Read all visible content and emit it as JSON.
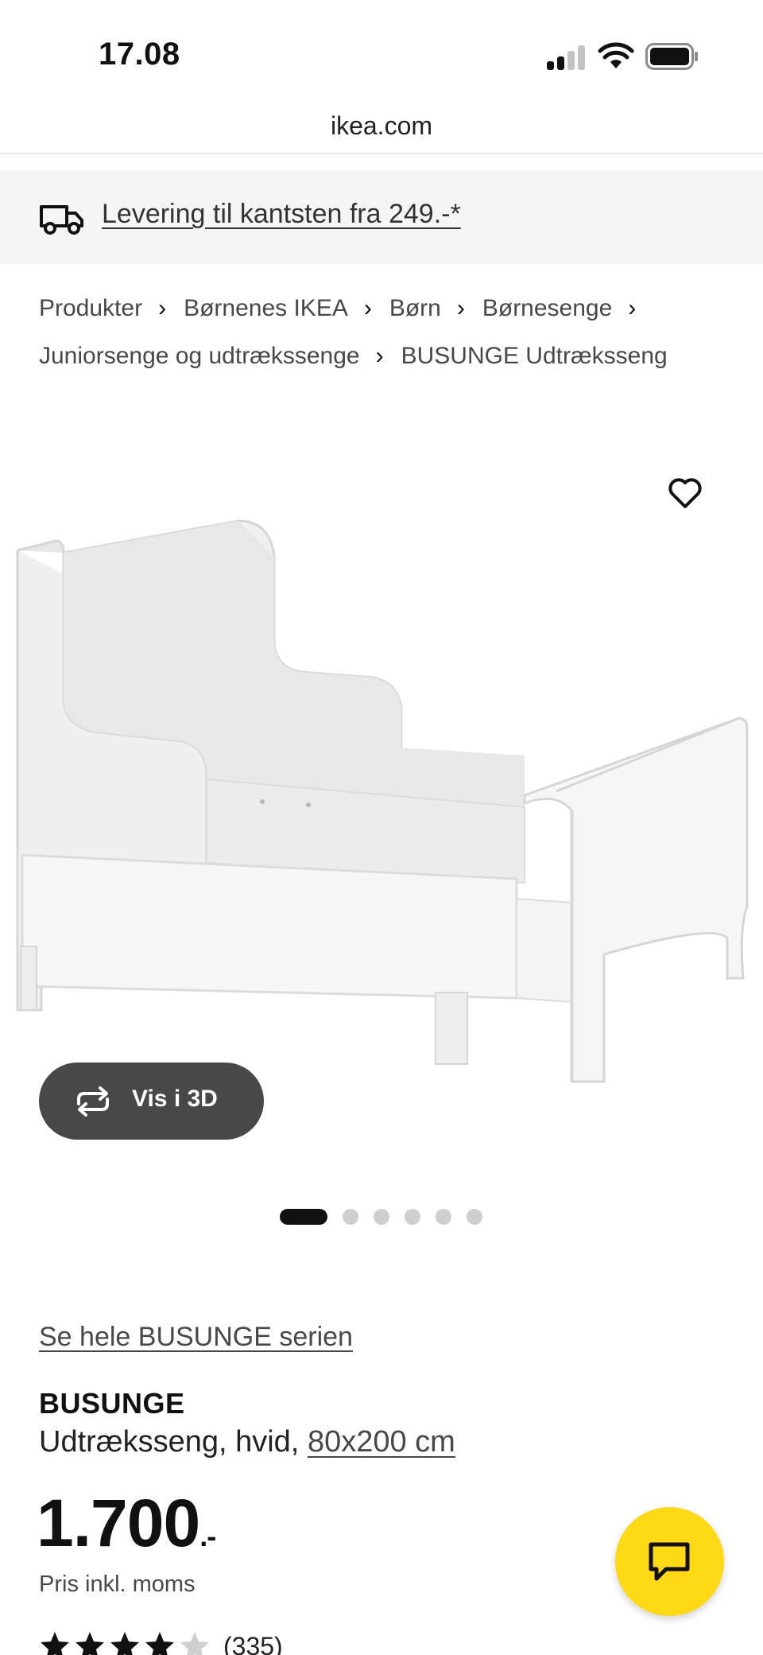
{
  "status_bar": {
    "time": "17.08",
    "icons": [
      "cellular-signal-icon",
      "wifi-icon",
      "battery-icon"
    ]
  },
  "browser": {
    "url": "ikea.com"
  },
  "delivery_banner": {
    "icon": "truck-icon",
    "text": "Levering til kantsten fra 249.-*"
  },
  "breadcrumb": {
    "items": [
      "Produkter",
      "Børnenes IKEA",
      "Børn",
      "Børnesenge",
      "Juniorsenge og udtrækssenge",
      "BUSUNGE Udtræksseng"
    ],
    "separator": "›"
  },
  "gallery": {
    "favorite_icon": "heart-icon",
    "view_3d_label": "Vis i 3D",
    "view_3d_icon": "rotate-arrows-icon",
    "image_count": 6,
    "active_index": 0
  },
  "product": {
    "series_link": "Se hele BUSUNGE serien",
    "name": "BUSUNGE",
    "description_prefix": "Udtræksseng, hvid,",
    "size": "80x200 cm",
    "price": "1.700",
    "price_suffix": ".-",
    "price_note": "Pris inkl. moms",
    "rating": 4.5,
    "review_count": "(335)"
  },
  "chat": {
    "icon": "chat-bubble-icon"
  },
  "colors": {
    "background": "#ffffff",
    "banner_background": "#f5f5f5",
    "button_dark": "#484848",
    "chat_yellow": "#fed914",
    "text_primary": "#111111",
    "text_secondary": "#484848"
  }
}
